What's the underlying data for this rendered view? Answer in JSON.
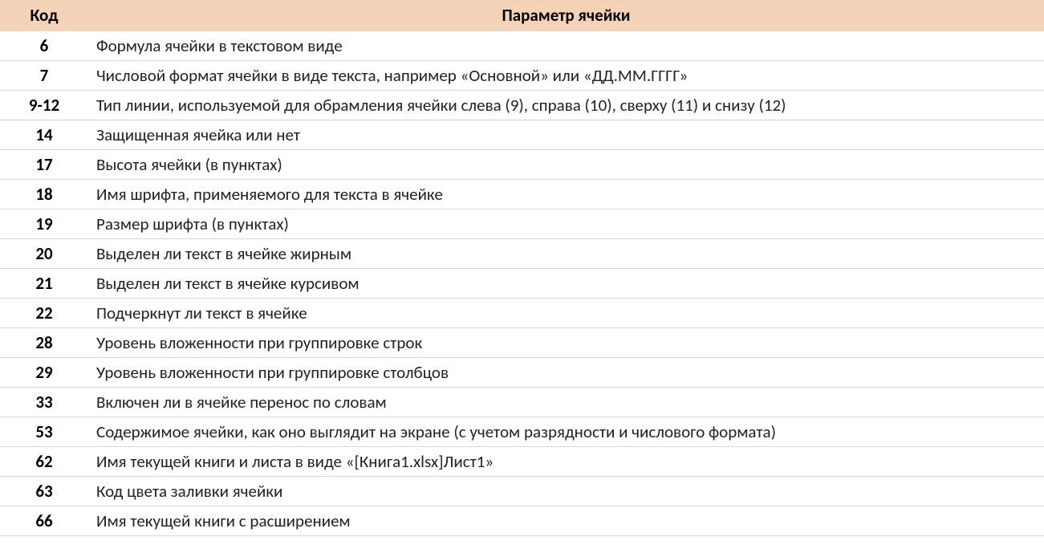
{
  "headers": {
    "code": "Код",
    "param": "Параметр ячейки"
  },
  "rows": [
    {
      "code": "6",
      "param": "Формула ячейки в текстовом виде"
    },
    {
      "code": "7",
      "param": "Числовой формат ячейки в виде текста, например «Основной» или «ДД.ММ.ГГГГ»"
    },
    {
      "code": "9-12",
      "param": "Тип линии, используемой для обрамления ячейки слева (9), справа (10), сверху (11) и снизу (12)"
    },
    {
      "code": "14",
      "param": "Защищенная ячейка или нет"
    },
    {
      "code": "17",
      "param": "Высота ячейки (в пунктах)"
    },
    {
      "code": "18",
      "param": "Имя шрифта, применяемого для текста в ячейке"
    },
    {
      "code": "19",
      "param": "Размер шрифта (в пунктах)"
    },
    {
      "code": "20",
      "param": "Выделен ли текст в ячейке жирным"
    },
    {
      "code": "21",
      "param": "Выделен ли текст в ячейке курсивом"
    },
    {
      "code": "22",
      "param": "Подчеркнут ли текст в ячейке"
    },
    {
      "code": "28",
      "param": "Уровень вложенности при группировке строк"
    },
    {
      "code": "29",
      "param": "Уровень вложенности при группировке столбцов"
    },
    {
      "code": "33",
      "param": "Включен ли в ячейке перенос по словам"
    },
    {
      "code": "53",
      "param": "Содержимое ячейки, как оно выглядит на экране (с учетом разрядности и числового формата)"
    },
    {
      "code": "62",
      "param": "Имя текущей книги и листа в виде «[Книга1.xlsx]Лист1»"
    },
    {
      "code": "63",
      "param": "Код цвета заливки ячейки"
    },
    {
      "code": "66",
      "param": "Имя текущей книги с расширением"
    }
  ]
}
